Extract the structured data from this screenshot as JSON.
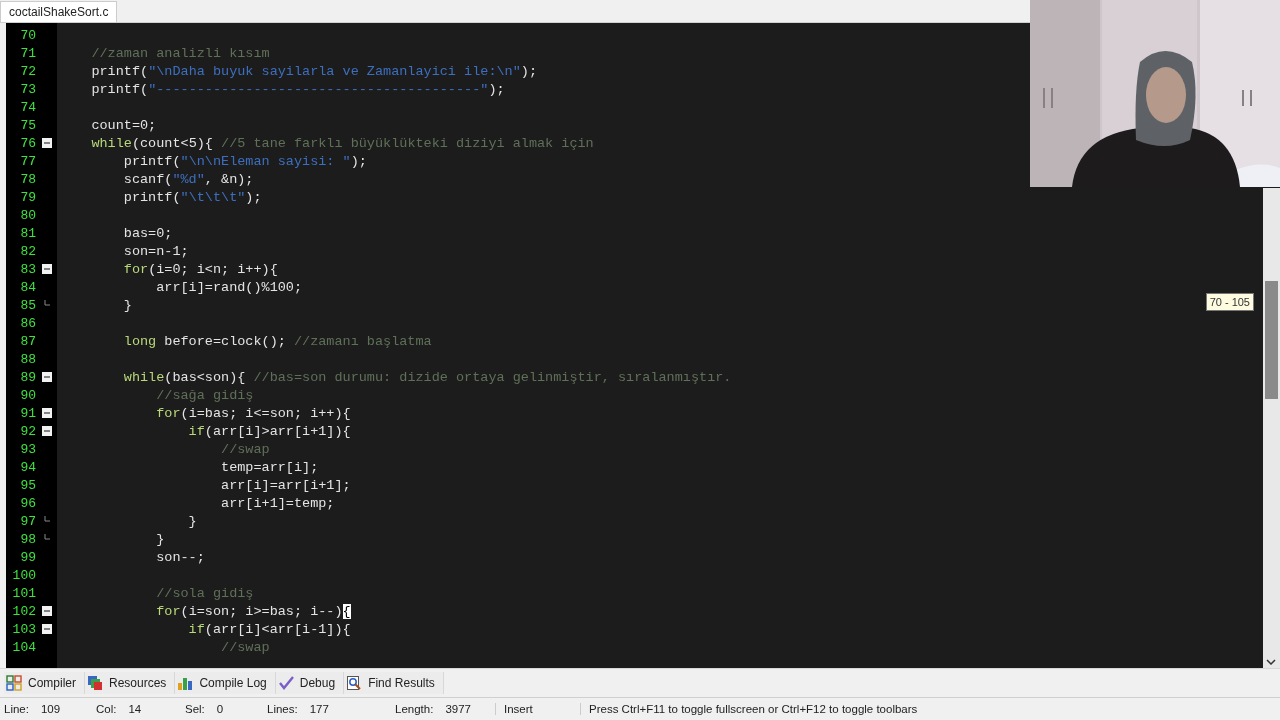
{
  "editor_tabs": [
    {
      "label": "coctailShakeSort.c",
      "selected": true
    }
  ],
  "code_lines": [
    {
      "number": "70",
      "collapsible": false,
      "block_end": false
    },
    {
      "number": "71",
      "collapsible": false,
      "block_end": false,
      "segments": [
        {
          "kind": "comment",
          "text": "    //zaman analizli kısım"
        }
      ]
    },
    {
      "number": "72",
      "collapsible": false,
      "block_end": false,
      "segments": [
        {
          "kind": "plain",
          "text": "    printf("
        },
        {
          "kind": "string",
          "text": "\"\\nDaha buyuk sayilarla ve Zamanlayici ile:\\n\""
        },
        {
          "kind": "plain",
          "text": ");"
        }
      ]
    },
    {
      "number": "73",
      "collapsible": false,
      "block_end": false,
      "segments": [
        {
          "kind": "plain",
          "text": "    printf("
        },
        {
          "kind": "string",
          "text": "\"----------------------------------------\""
        },
        {
          "kind": "plain",
          "text": ");"
        }
      ]
    },
    {
      "number": "74",
      "collapsible": false,
      "block_end": false
    },
    {
      "number": "75",
      "collapsible": false,
      "block_end": false,
      "segments": [
        {
          "kind": "plain",
          "text": "    count=0;"
        }
      ]
    },
    {
      "number": "76",
      "collapsible": true,
      "block_end": false,
      "segments": [
        {
          "kind": "keyword",
          "text": "    while"
        },
        {
          "kind": "plain",
          "text": "(count<5){ "
        },
        {
          "kind": "comment",
          "text": "//5 tane farklı büyüklükteki diziyi almak için"
        }
      ]
    },
    {
      "number": "77",
      "collapsible": false,
      "block_end": false,
      "segments": [
        {
          "kind": "plain",
          "text": "        printf("
        },
        {
          "kind": "string",
          "text": "\"\\n\\nEleman sayisi: \""
        },
        {
          "kind": "plain",
          "text": ");"
        }
      ]
    },
    {
      "number": "78",
      "collapsible": false,
      "block_end": false,
      "segments": [
        {
          "kind": "plain",
          "text": "        scanf("
        },
        {
          "kind": "string",
          "text": "\"%d\""
        },
        {
          "kind": "plain",
          "text": ", &n);"
        }
      ]
    },
    {
      "number": "79",
      "collapsible": false,
      "block_end": false,
      "segments": [
        {
          "kind": "plain",
          "text": "        printf("
        },
        {
          "kind": "string",
          "text": "\"\\t\\t\\t\""
        },
        {
          "kind": "plain",
          "text": ");"
        }
      ]
    },
    {
      "number": "80",
      "collapsible": false,
      "block_end": false
    },
    {
      "number": "81",
      "collapsible": false,
      "block_end": false,
      "segments": [
        {
          "kind": "plain",
          "text": "        bas=0;"
        }
      ]
    },
    {
      "number": "82",
      "collapsible": false,
      "block_end": false,
      "segments": [
        {
          "kind": "plain",
          "text": "        son=n-1;"
        }
      ]
    },
    {
      "number": "83",
      "collapsible": true,
      "block_end": false,
      "segments": [
        {
          "kind": "keyword",
          "text": "        for"
        },
        {
          "kind": "plain",
          "text": "(i=0; i<n; i++){"
        }
      ]
    },
    {
      "number": "84",
      "collapsible": false,
      "block_end": false,
      "segments": [
        {
          "kind": "plain",
          "text": "            arr[i]=rand()%100;"
        }
      ]
    },
    {
      "number": "85",
      "collapsible": false,
      "block_end": true,
      "segments": [
        {
          "kind": "plain",
          "text": "        }"
        }
      ]
    },
    {
      "number": "86",
      "collapsible": false,
      "block_end": false
    },
    {
      "number": "87",
      "collapsible": false,
      "block_end": false,
      "segments": [
        {
          "kind": "keyword",
          "text": "        long"
        },
        {
          "kind": "plain",
          "text": " before=clock(); "
        },
        {
          "kind": "comment",
          "text": "//zamanı başlatma"
        }
      ]
    },
    {
      "number": "88",
      "collapsible": false,
      "block_end": false
    },
    {
      "number": "89",
      "collapsible": true,
      "block_end": false,
      "segments": [
        {
          "kind": "keyword",
          "text": "        while"
        },
        {
          "kind": "plain",
          "text": "(bas<son){ "
        },
        {
          "kind": "comment",
          "text": "//bas=son durumu: dizide ortaya gelinmiştir, sıralanmıştır."
        }
      ]
    },
    {
      "number": "90",
      "collapsible": false,
      "block_end": false,
      "segments": [
        {
          "kind": "comment",
          "text": "            //sağa gidiş"
        }
      ]
    },
    {
      "number": "91",
      "collapsible": true,
      "block_end": false,
      "segments": [
        {
          "kind": "keyword",
          "text": "            for"
        },
        {
          "kind": "plain",
          "text": "(i=bas; i<=son; i++){"
        }
      ]
    },
    {
      "number": "92",
      "collapsible": true,
      "block_end": false,
      "segments": [
        {
          "kind": "keyword",
          "text": "                if"
        },
        {
          "kind": "plain",
          "text": "(arr[i]>arr[i+1]){"
        }
      ]
    },
    {
      "number": "93",
      "collapsible": false,
      "block_end": false,
      "segments": [
        {
          "kind": "comment",
          "text": "                    //swap"
        }
      ]
    },
    {
      "number": "94",
      "collapsible": false,
      "block_end": false,
      "segments": [
        {
          "kind": "plain",
          "text": "                    temp=arr[i];"
        }
      ]
    },
    {
      "number": "95",
      "collapsible": false,
      "block_end": false,
      "segments": [
        {
          "kind": "plain",
          "text": "                    arr[i]=arr[i+1];"
        }
      ]
    },
    {
      "number": "96",
      "collapsible": false,
      "block_end": false,
      "segments": [
        {
          "kind": "plain",
          "text": "                    arr[i+1]=temp;"
        }
      ]
    },
    {
      "number": "97",
      "collapsible": false,
      "block_end": true,
      "segments": [
        {
          "kind": "plain",
          "text": "                }"
        }
      ]
    },
    {
      "number": "98",
      "collapsible": false,
      "block_end": true,
      "segments": [
        {
          "kind": "plain",
          "text": "            }"
        }
      ]
    },
    {
      "number": "99",
      "collapsible": false,
      "block_end": false,
      "segments": [
        {
          "kind": "plain",
          "text": "            son--;"
        }
      ]
    },
    {
      "number": "100",
      "collapsible": false,
      "block_end": false
    },
    {
      "number": "101",
      "collapsible": false,
      "block_end": false,
      "segments": [
        {
          "kind": "comment",
          "text": "            //sola gidiş"
        }
      ]
    },
    {
      "number": "102",
      "collapsible": true,
      "block_end": false,
      "segments": [
        {
          "kind": "keyword",
          "text": "            for"
        },
        {
          "kind": "plain",
          "text": "(i=son; i>=bas; i--)"
        },
        {
          "kind": "bracket_match",
          "text": "{"
        }
      ]
    },
    {
      "number": "103",
      "collapsible": true,
      "block_end": false,
      "segments": [
        {
          "kind": "keyword",
          "text": "                if"
        },
        {
          "kind": "plain",
          "text": "(arr[i]<arr[i-1]){"
        }
      ]
    },
    {
      "number": "104",
      "collapsible": false,
      "block_end": false,
      "segments": [
        {
          "kind": "comment",
          "text": "                    //swap"
        }
      ]
    }
  ],
  "scroll_tooltip": "70 - 105",
  "panel_tabs": [
    {
      "kind": "compiler",
      "label": "Compiler"
    },
    {
      "kind": "resources",
      "label": "Resources"
    },
    {
      "kind": "log",
      "label": "Compile Log"
    },
    {
      "kind": "debug",
      "label": "Debug"
    },
    {
      "kind": "find",
      "label": "Find Results"
    }
  ],
  "status_bar": {
    "fields": [
      {
        "label": "Line:",
        "value": "109"
      },
      {
        "label": "Col:",
        "value": "14"
      },
      {
        "label": "Sel:",
        "value": "0"
      },
      {
        "label": "Lines:",
        "value": "177"
      },
      {
        "label": "Length:",
        "value": "3977"
      }
    ],
    "mode": "Insert",
    "hint": "Press Ctrl+F11 to toggle fullscreen or Ctrl+F12 to toggle toolbars"
  }
}
